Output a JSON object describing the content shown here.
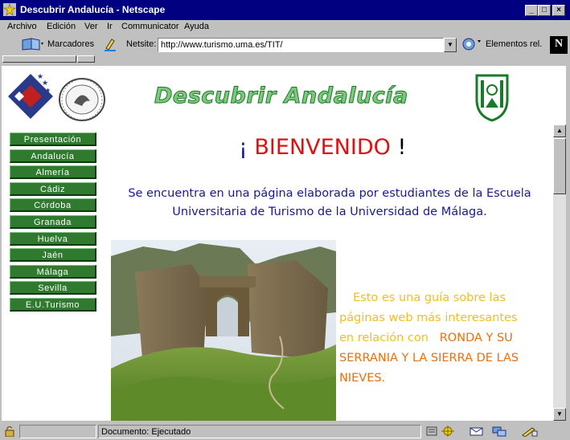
{
  "window": {
    "title": "Descubrir Andalucía - Netscape"
  },
  "menu": [
    "Archivo",
    "Edición",
    "Ver",
    "Ir",
    "Communicator",
    "Ayuda"
  ],
  "location_bar": {
    "bookmarks_label": "Marcadores",
    "netsite_label": "Netsite:",
    "url": "http://www.turismo.uma.es/TIT/",
    "related_label": "Elementos rel."
  },
  "page": {
    "site_title": "Descubrir Andalucía",
    "nav": [
      "Presentación",
      "Andalucía",
      "Almería",
      "Cádiz",
      "Córdoba",
      "Granada",
      "Huelva",
      "Jaén",
      "Málaga",
      "Sevilla",
      "E.U.Turismo"
    ],
    "welcome": {
      "pre": "¡ ",
      "word": "BIENVENIDO",
      "post": " !"
    },
    "intro": "Se encuentra en una página elaborada por estudiantes de la Escuela Universitaria de Turismo de la Universidad de Málaga.",
    "guide": {
      "line1": "Esto es una guía sobre las",
      "line2": "páginas web más interesantes",
      "line3": "en relación con",
      "highlight": "RONDA Y SU SERRANIA Y LA SIERRA DE LAS NIEVES."
    }
  },
  "status": {
    "text": "Documento: Ejecutado"
  },
  "colors": {
    "titlebar": "#000080",
    "nav_button": "#2f7a2f",
    "welcome_red": "#e01010",
    "intro_blue": "#1a1a90",
    "guide_yellow": "#f0c020",
    "guide_orange": "#e8700e"
  },
  "icons": [
    "netscape-app-icon",
    "bookmarks-icon",
    "edit-pencil-icon",
    "related-links-icon",
    "netscape-n-logo",
    "security-lock-icon",
    "component-icons"
  ]
}
